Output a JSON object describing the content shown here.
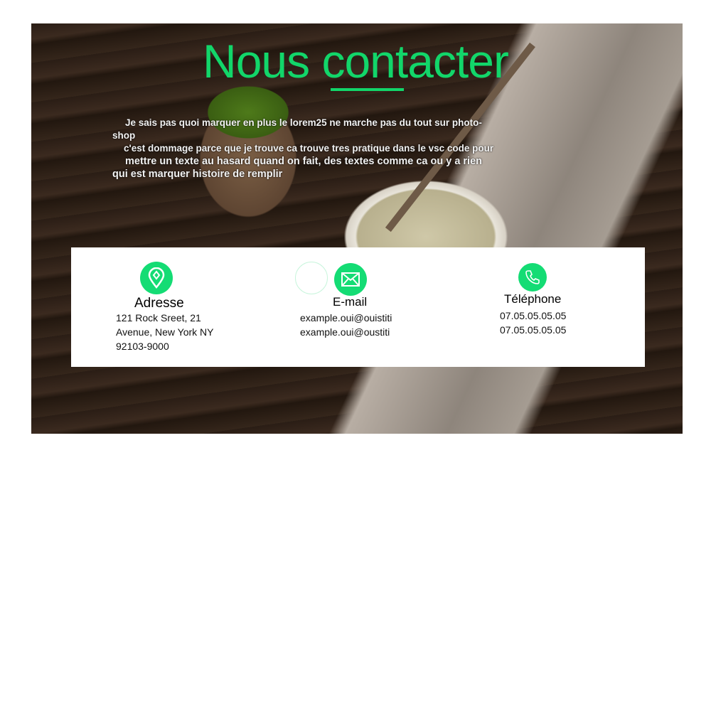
{
  "header": {
    "title": "Nous contacter"
  },
  "intro": {
    "lines": [
      "Je sais pas quoi marquer en plus le lorem25 ne marche pas du tout sur photo-",
      "shop",
      "c'est dommage parce que je trouve ca trouve tres pratique dans le vsc code pour",
      "mettre un texte au hasard quand on fait, des textes comme ca ou y a rien",
      "qui est marquer histoire de remplir"
    ]
  },
  "contact": {
    "accent": "#14dc74",
    "address": {
      "icon": "map-pin-icon",
      "label": "Adresse",
      "lines": [
        "121 Rock Sreet, 21",
        "Avenue, New York NY",
        "92103-9000"
      ]
    },
    "email": {
      "icon": "envelope-icon",
      "label": "E-mail",
      "lines": [
        "example.oui@ouistiti",
        "example.oui@oustiti"
      ]
    },
    "phone": {
      "icon": "phone-icon",
      "label": "Téléphone",
      "lines": [
        "07.05.05.05.05",
        "07.05.05.05.05"
      ]
    }
  }
}
